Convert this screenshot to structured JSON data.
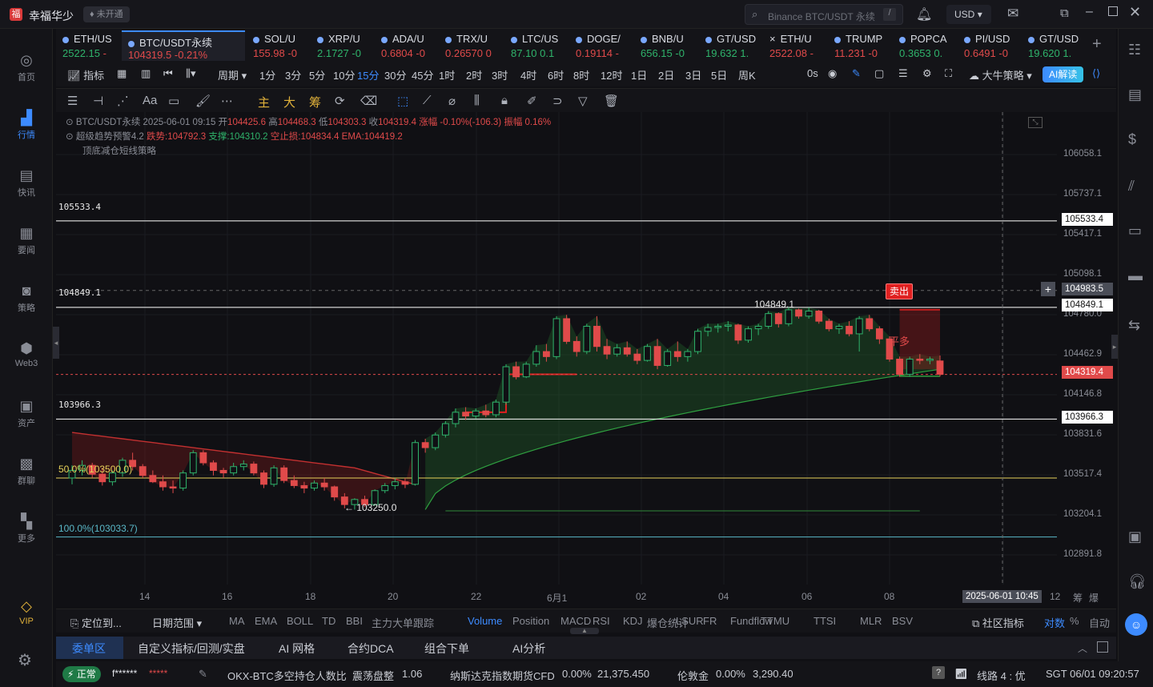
{
  "app": {
    "title": "幸福华少",
    "badge": "未开通"
  },
  "search": {
    "placeholder": "Binance BTC/USDT 永续",
    "hotkey": "/"
  },
  "currency": "USD",
  "sidebar": {
    "items": [
      {
        "label": "首页",
        "icon": "home-icon"
      },
      {
        "label": "行情",
        "icon": "chart-bar-icon"
      },
      {
        "label": "快讯",
        "icon": "news-icon"
      },
      {
        "label": "要闻",
        "icon": "document-icon"
      },
      {
        "label": "策略",
        "icon": "robot-icon"
      },
      {
        "label": "Web3",
        "icon": "web3-icon"
      },
      {
        "label": "资产",
        "icon": "wallet-icon"
      },
      {
        "label": "群聊",
        "icon": "chat-icon"
      },
      {
        "label": "更多",
        "icon": "grid-icon"
      },
      {
        "label": "VIP",
        "icon": "diamond-icon"
      }
    ]
  },
  "tickers": [
    {
      "name": "ETH/US",
      "price": "2522.15",
      "change": "-",
      "dir": "dn"
    },
    {
      "name": "BTC/USDT永续",
      "price": "104319.5",
      "change": "-0.21%",
      "dir": "dn"
    },
    {
      "name": "SOL/U",
      "price": "155.98",
      "change": "-0",
      "dir": "dn"
    },
    {
      "name": "XRP/U",
      "price": "2.1727",
      "change": "-0",
      "dir": "up"
    },
    {
      "name": "ADA/U",
      "price": "0.6804",
      "change": "-0",
      "dir": "dn"
    },
    {
      "name": "TRX/U",
      "price": "0.26570",
      "change": "0",
      "dir": "dn"
    },
    {
      "name": "LTC/US",
      "price": "87.10",
      "change": "0.1",
      "dir": "up"
    },
    {
      "name": "DOGE/",
      "price": "0.19114",
      "change": "-",
      "dir": "dn"
    },
    {
      "name": "BNB/U",
      "price": "656.15",
      "change": "-0",
      "dir": "up"
    },
    {
      "name": "GT/USD",
      "price": "19.632",
      "change": "1.",
      "dir": "up"
    },
    {
      "name": "ETH/U",
      "price": "2522.08",
      "change": "-",
      "dir": "dn"
    },
    {
      "name": "TRUMP",
      "price": "11.231",
      "change": "-0",
      "dir": "dn"
    },
    {
      "name": "POPCA",
      "price": "0.3653",
      "change": "0.",
      "dir": "up"
    },
    {
      "name": "PI/USD",
      "price": "0.6491",
      "change": "-0",
      "dir": "dn"
    },
    {
      "name": "GT/USD",
      "price": "19.620",
      "change": "1.",
      "dir": "up"
    }
  ],
  "toolbar1": {
    "indicators": "指标",
    "period": "周期",
    "intervals": [
      "1分",
      "3分",
      "5分",
      "10分",
      "15分",
      "30分",
      "45分",
      "1时",
      "2时",
      "3时",
      "4时",
      "6时",
      "8时",
      "12时",
      "1日",
      "2日",
      "3日",
      "5日",
      "周K"
    ],
    "selected_interval": "15分",
    "countdown": "0s",
    "strategy": "大牛策略",
    "ai": "AI解读"
  },
  "toolbar2": {
    "text_tools": [
      "主",
      "大",
      "筹"
    ]
  },
  "legend": {
    "line1": "BTC/USDT永续 2025-06-01 09:15",
    "o_lbl": "开",
    "o": "104425.6",
    "h_lbl": "高",
    "h": "104468.3",
    "l_lbl": "低",
    "l": "104303.3",
    "c_lbl": "收",
    "c": "104319.4",
    "chg": "涨幅 -0.10%(-106.3)",
    "amp": "振幅 0.16%",
    "ind1_name": "超级趋势预警4.2",
    "ind1_a": "跌势:104792.3",
    "ind1_b": "支撑:104310.2",
    "ind1_c": "空止损:104834.4",
    "ind1_d": "EMA:104419.2",
    "ind2_name": "顶底减仓短线策略"
  },
  "chart_labels": {
    "h1": "105533.4",
    "h2": "104849.1",
    "h3": "103966.3",
    "fib50": "50.0%(103500.0)",
    "fib100": "100.0%(103033.7)",
    "low_mark": "← 103250.0",
    "high_mark": "104849.1",
    "sell_tag": "卖出",
    "flat_long": "平多"
  },
  "y_axis": {
    "ticks": [
      "106058.1",
      "105737.1",
      "105417.1",
      "105098.1",
      "104780.0",
      "104462.9",
      "104146.8",
      "103831.6",
      "103517.4",
      "103204.1",
      "102891.8"
    ],
    "flags": {
      "f1": "105533.4",
      "f2": "104983.5",
      "f3": "104849.1",
      "f4": "104319.4",
      "f5": "103966.3"
    }
  },
  "x_axis": {
    "ticks": [
      "14",
      "16",
      "18",
      "20",
      "22",
      "6月1",
      "02",
      "04",
      "06",
      "08",
      "12"
    ],
    "cursor": "2025-06-01 10:45",
    "end_a": "筹",
    "end_b": "爆"
  },
  "chart_data": {
    "type": "candlestick",
    "symbol": "BTC/USDT永续",
    "interval": "15分",
    "ylim": [
      102800,
      106150
    ],
    "candles_ohlc": [
      [
        103500,
        103600,
        103450,
        103560
      ],
      [
        103560,
        103640,
        103520,
        103600
      ],
      [
        103600,
        103620,
        103500,
        103530
      ],
      [
        103530,
        103580,
        103440,
        103470
      ],
      [
        103470,
        103560,
        103440,
        103540
      ],
      [
        103540,
        103660,
        103510,
        103640
      ],
      [
        103640,
        103700,
        103560,
        103590
      ],
      [
        103590,
        103610,
        103500,
        103520
      ],
      [
        103520,
        103560,
        103460,
        103470
      ],
      [
        103470,
        103520,
        103400,
        103430
      ],
      [
        103430,
        103480,
        103380,
        103420
      ],
      [
        103420,
        103560,
        103400,
        103540
      ],
      [
        103540,
        103720,
        103520,
        103700
      ],
      [
        103700,
        103720,
        103600,
        103620
      ],
      [
        103620,
        103640,
        103520,
        103560
      ],
      [
        103560,
        103580,
        103500,
        103540
      ],
      [
        103540,
        103620,
        103520,
        103590
      ],
      [
        103590,
        103640,
        103560,
        103610
      ],
      [
        103610,
        103630,
        103520,
        103540
      ],
      [
        103540,
        103560,
        103420,
        103450
      ],
      [
        103450,
        103600,
        103430,
        103580
      ],
      [
        103580,
        103600,
        103460,
        103480
      ],
      [
        103480,
        103520,
        103420,
        103440
      ],
      [
        103440,
        103470,
        103380,
        103420
      ],
      [
        103420,
        103480,
        103400,
        103460
      ],
      [
        103460,
        103500,
        103400,
        103430
      ],
      [
        103430,
        103440,
        103320,
        103350
      ],
      [
        103350,
        103380,
        103260,
        103290
      ],
      [
        103290,
        103340,
        103250,
        103330
      ],
      [
        103330,
        103360,
        103270,
        103290
      ],
      [
        103290,
        103410,
        103280,
        103400
      ],
      [
        103400,
        103460,
        103380,
        103440
      ],
      [
        103440,
        103500,
        103410,
        103470
      ],
      [
        103470,
        103500,
        103420,
        103450
      ],
      [
        103450,
        103800,
        103440,
        103780
      ],
      [
        103780,
        103810,
        103700,
        103740
      ],
      [
        103740,
        103860,
        103720,
        103840
      ],
      [
        103840,
        103950,
        103820,
        103930
      ],
      [
        103930,
        104050,
        103900,
        104020
      ],
      [
        104020,
        104060,
        103960,
        103990
      ],
      [
        103990,
        104050,
        103970,
        104030
      ],
      [
        104030,
        104080,
        103980,
        104000
      ],
      [
        104000,
        104120,
        103980,
        104100
      ],
      [
        104100,
        104400,
        104080,
        104380
      ],
      [
        104380,
        104420,
        104280,
        104300
      ],
      [
        104300,
        104420,
        104290,
        104400
      ],
      [
        104400,
        104550,
        104380,
        104500
      ],
      [
        104500,
        104560,
        104420,
        104460
      ],
      [
        104460,
        104780,
        104440,
        104760
      ],
      [
        104760,
        104790,
        104560,
        104580
      ],
      [
        104580,
        104620,
        104460,
        104500
      ],
      [
        104500,
        104720,
        104480,
        104700
      ],
      [
        104700,
        104780,
        104500,
        104540
      ],
      [
        104540,
        104600,
        104440,
        104480
      ],
      [
        104480,
        104560,
        104460,
        104530
      ],
      [
        104530,
        104580,
        104460,
        104480
      ],
      [
        104480,
        104520,
        104400,
        104430
      ],
      [
        104430,
        104560,
        104420,
        104540
      ],
      [
        104540,
        104600,
        104360,
        104390
      ],
      [
        104390,
        104520,
        104380,
        104500
      ],
      [
        104500,
        104580,
        104420,
        104460
      ],
      [
        104460,
        104520,
        104420,
        104500
      ],
      [
        104500,
        104680,
        104480,
        104660
      ],
      [
        104660,
        104720,
        104620,
        104690
      ],
      [
        104690,
        104720,
        104650,
        104700
      ],
      [
        104700,
        104740,
        104660,
        104710
      ],
      [
        104710,
        104720,
        104560,
        104590
      ],
      [
        104590,
        104700,
        104570,
        104680
      ],
      [
        104680,
        104720,
        104630,
        104700
      ],
      [
        104700,
        104820,
        104680,
        104800
      ],
      [
        104800,
        104810,
        104690,
        104720
      ],
      [
        104720,
        104850,
        104700,
        104830
      ],
      [
        104830,
        104840,
        104760,
        104780
      ],
      [
        104780,
        104849,
        104760,
        104820
      ],
      [
        104820,
        104830,
        104720,
        104740
      ],
      [
        104740,
        104760,
        104660,
        104680
      ],
      [
        104680,
        104720,
        104640,
        104700
      ],
      [
        104700,
        104740,
        104620,
        104640
      ],
      [
        104640,
        104780,
        104500,
        104760
      ],
      [
        104760,
        104790,
        104660,
        104680
      ],
      [
        104680,
        104700,
        104560,
        104600
      ],
      [
        104600,
        104620,
        104420,
        104440
      ],
      [
        104440,
        104460,
        104300,
        104320
      ],
      [
        104320,
        104460,
        104300,
        104440
      ],
      [
        104440,
        104480,
        104400,
        104430
      ],
      [
        104430,
        104460,
        104400,
        104440
      ],
      [
        104425.6,
        104468.3,
        104303.3,
        104319.4
      ]
    ],
    "levels": [
      105533.4,
      104849.1,
      103966.3
    ],
    "fib": [
      {
        "label": "50.0%",
        "value": 103500.0
      },
      {
        "label": "100.0%",
        "value": 103033.7
      }
    ],
    "last_price": 104319.4,
    "crosshair_price": 104983.5
  },
  "indicator_bar": {
    "locate": "定位到...",
    "range": "日期范围",
    "items": [
      "MA",
      "EMA",
      "BOLL",
      "TD",
      "BBI",
      "主力大单跟踪"
    ],
    "items2": [
      "Volume",
      "Position",
      "MACD",
      "RSI",
      "KDJ",
      "爆仓统计",
      "LSUR",
      "FR",
      "Fundflow",
      "TTMU",
      "TTSI",
      "MLR",
      "BSV"
    ],
    "selected": "Volume",
    "community": "社区指标",
    "log": "对数",
    "pct": "%",
    "auto": "自动"
  },
  "bottom_tabs": [
    "委单区",
    "自定义指标/回测/实盘",
    "AI 网格",
    "合约DCA",
    "组合下单",
    "AI分析"
  ],
  "status": {
    "state": "正常",
    "user": "f******",
    "pwd": "*****",
    "ls_ratio_label": "OKX-BTC多空持仓人数比",
    "ls_state": "震荡盘整",
    "ls_val": "1.06",
    "nq_label": "纳斯达克指数期货CFD",
    "nq_chg": "0.00%",
    "nq_val": "21,375.450",
    "gold_label": "伦敦金",
    "gold_chg": "0.00%",
    "gold_val": "3,290.40",
    "line": "线路 4 : 优",
    "time": "SGT 06/01 09:20:57"
  },
  "colors": {
    "up": "#2fb36b",
    "down": "#e04a4a",
    "accent": "#3d8bff",
    "background": "#101014"
  }
}
